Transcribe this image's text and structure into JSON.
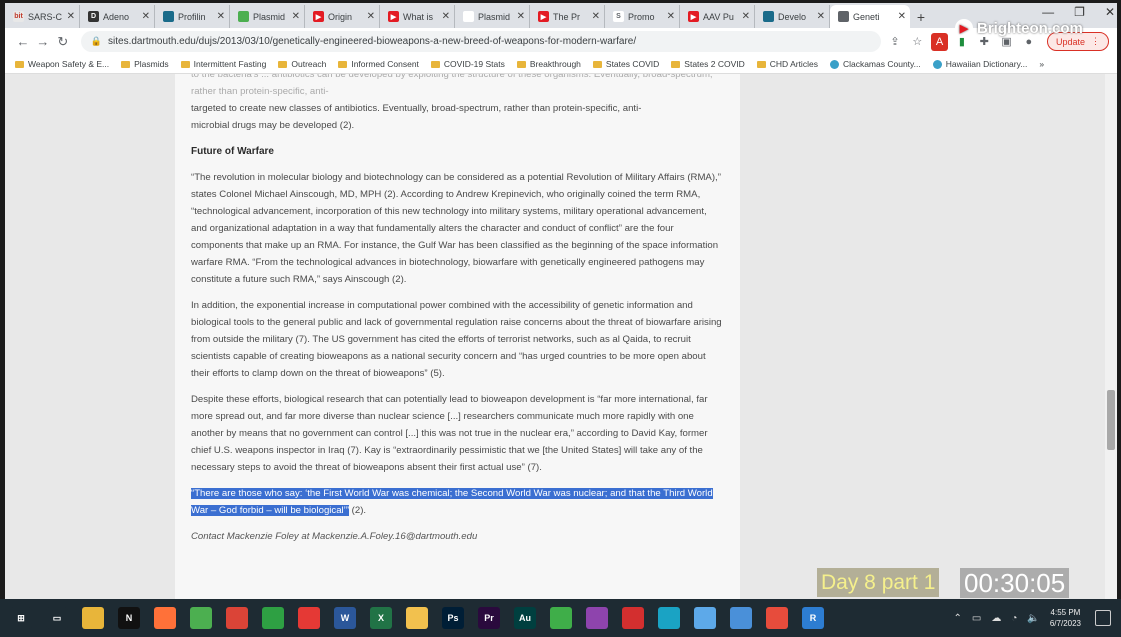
{
  "tabs": [
    {
      "title": "SARS-C",
      "fav": "bit",
      "color": "#e8e8e8",
      "fg": "#c0392b"
    },
    {
      "title": "Adeno",
      "fav": "D",
      "color": "#333333",
      "fg": "#ffffff"
    },
    {
      "title": "Profilin",
      "fav": "",
      "color": "#1a6b8a",
      "fg": "#ffffff"
    },
    {
      "title": "Plasmid",
      "fav": "",
      "color": "#4caf50",
      "fg": "#ffffff"
    },
    {
      "title": "Origin",
      "fav": "▶",
      "color": "#e31b23",
      "fg": "#ffffff"
    },
    {
      "title": "What is",
      "fav": "▶",
      "color": "#e31b23",
      "fg": "#ffffff"
    },
    {
      "title": "Plasmid",
      "fav": "",
      "color": "#ffffff",
      "fg": "#1a73e8"
    },
    {
      "title": "The Pr",
      "fav": "▶",
      "color": "#e31b23",
      "fg": "#ffffff"
    },
    {
      "title": "Promo",
      "fav": "S",
      "color": "#ffffff",
      "fg": "#5f6368"
    },
    {
      "title": "AAV Pu",
      "fav": "▶",
      "color": "#e31b23",
      "fg": "#ffffff"
    },
    {
      "title": "Develo",
      "fav": "",
      "color": "#1a6b8a",
      "fg": "#ffffff"
    },
    {
      "title": "Geneti",
      "fav": "",
      "color": "#5f6368",
      "fg": "#ffffff",
      "active": true
    }
  ],
  "overlay": {
    "brand": "Brighteon.com",
    "day_label": "Day 8 part 1",
    "timer": "00:30:05"
  },
  "toolbar": {
    "url": "sites.dartmouth.edu/dujs/2013/03/10/genetically-engineered-bioweapons-a-new-breed-of-weapons-for-modern-warfare/",
    "update_label": "Update"
  },
  "bookmarks": [
    {
      "label": "Weapon Safety & E...",
      "type": "folder"
    },
    {
      "label": "Plasmids",
      "type": "folder"
    },
    {
      "label": "Intermittent Fasting",
      "type": "folder"
    },
    {
      "label": "Outreach",
      "type": "folder"
    },
    {
      "label": "Informed Consent",
      "type": "folder"
    },
    {
      "label": "COVID-19 Stats",
      "type": "folder"
    },
    {
      "label": "Breakthrough",
      "type": "folder"
    },
    {
      "label": "States COVID",
      "type": "folder"
    },
    {
      "label": "States 2 COVID",
      "type": "folder"
    },
    {
      "label": "CHD Articles",
      "type": "folder"
    },
    {
      "label": "Clackamas County...",
      "type": "site"
    },
    {
      "label": "Hawaiian Dictionary...",
      "type": "site"
    }
  ],
  "article": {
    "top_cut": "to the bacteria's ... antibiotics can be developed by exploiting the structure of these organisms. Eventually, broad-spectrum, rather than protein-specific, anti-",
    "top_line1": "targeted to create new classes of antibiotics. Eventually, broad-spectrum, rather than protein-specific, anti-",
    "top_line2": "microbial drugs may be developed (2).",
    "heading": "Future of Warfare",
    "p1": "“The revolution in molecular biology and biotechnology can be considered as a potential Revolution of Military Affairs (RMA),” states Colonel Michael Ainscough, MD, MPH (2). According to Andrew Krepinevich, who originally coined the term RMA, “technological advancement, incorporation of this new technology into military systems, military operational advancement, and organizational adaptation in a way that fundamentally alters the character and conduct of conflict” are the four components that make up an RMA. For instance, the Gulf War has been classified as the beginning of the space information warfare RMA. “From the technological advances in biotechnology, biowarfare with genetically engineered pathogens may constitute a future such RMA,” says Ainscough (2).",
    "p2": "In addition, the exponential increase in computational power combined with the accessibility of genetic information and biological tools to the general public and lack of governmental regulation raise concerns about the threat of biowarfare arising from outside the military (7). The US government has cited the efforts of terrorist networks, such as al Qaida, to recruit scientists capable of creating bioweapons as a national security concern and “has urged countries to be more open about their efforts to clamp down on the threat of bioweapons” (5).",
    "p3": "Despite these efforts, biological research that can potentially lead to bioweapon development is “far more international, far more spread out, and far more diverse than nuclear science [...] researchers communicate much more rapidly with one another by means that no government can control [...] this was not true in the nuclear era,” according to David Kay, former chief U.S. weapons inspector in Iraq (7). Kay is “extraordinarily pessimistic that we [the United States] will take any of the necessary steps to avoid the threat of bioweapons absent their first actual use” (7).",
    "quote": "“There are those who say: ‘the First World War was chemical; the Second World War was nuclear; and that the Third World War – God forbid – will be biological’”",
    "quote_ref": " (2).",
    "contact": "Contact Mackenzie Foley at Mackenzie.A.Foley.16@dartmouth.edu"
  },
  "taskbar": {
    "apps": [
      {
        "name": "start",
        "glyph": "⊞",
        "color": "#1e2b33"
      },
      {
        "name": "task-view",
        "glyph": "▭",
        "color": "#1e2b33"
      },
      {
        "name": "file-explorer",
        "glyph": "",
        "color": "#e8b53a"
      },
      {
        "name": "netflix",
        "glyph": "N",
        "color": "#111111"
      },
      {
        "name": "firefox",
        "glyph": "",
        "color": "#ff7139"
      },
      {
        "name": "chrome",
        "glyph": "",
        "color": "#4caf50"
      },
      {
        "name": "chrome-alt",
        "glyph": "",
        "color": "#db4437"
      },
      {
        "name": "green-app",
        "glyph": "",
        "color": "#2ea043"
      },
      {
        "name": "red-app",
        "glyph": "",
        "color": "#e53935"
      },
      {
        "name": "word",
        "glyph": "W",
        "color": "#2b579a"
      },
      {
        "name": "excel",
        "glyph": "X",
        "color": "#217346"
      },
      {
        "name": "yellow-app",
        "glyph": "",
        "color": "#f2c14e"
      },
      {
        "name": "photoshop",
        "glyph": "Ps",
        "color": "#001e36"
      },
      {
        "name": "premiere",
        "glyph": "Pr",
        "color": "#2a0a3d"
      },
      {
        "name": "audition",
        "glyph": "Au",
        "color": "#003f3f"
      },
      {
        "name": "green-square",
        "glyph": "",
        "color": "#3fae49"
      },
      {
        "name": "photos",
        "glyph": "",
        "color": "#8e44ad"
      },
      {
        "name": "acrobat",
        "glyph": "",
        "color": "#d32f2f"
      },
      {
        "name": "cyan-app",
        "glyph": "",
        "color": "#1aa3c4"
      },
      {
        "name": "paint",
        "glyph": "",
        "color": "#5da9e9"
      },
      {
        "name": "calculator",
        "glyph": "",
        "color": "#4a90d9"
      },
      {
        "name": "red-round",
        "glyph": "",
        "color": "#e74c3c"
      },
      {
        "name": "r-app",
        "glyph": "R",
        "color": "#2d7dd2"
      }
    ],
    "time": "4:55 PM",
    "date": "6/7/2023"
  }
}
